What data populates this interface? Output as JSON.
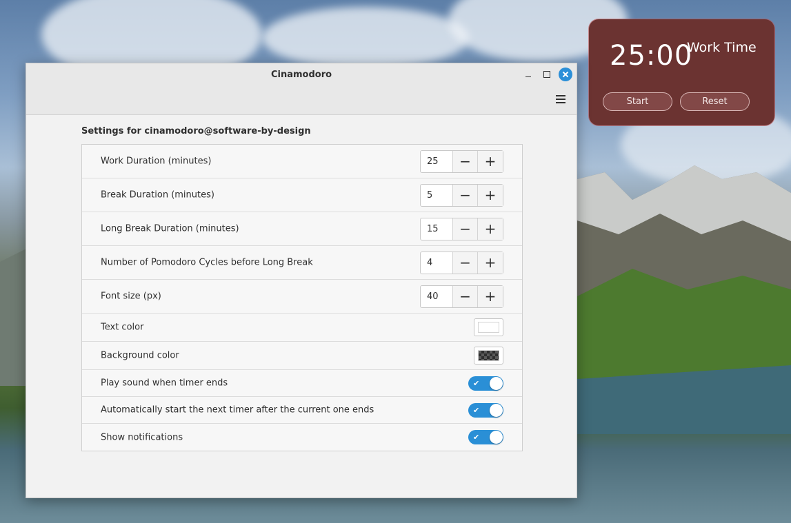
{
  "window": {
    "title": "Cinamodoro",
    "heading": "Settings for cinamodoro@software-by-design"
  },
  "timer": {
    "time": "25:00",
    "mode": "Work Time",
    "start_label": "Start",
    "reset_label": "Reset"
  },
  "settings": {
    "spin_rows": [
      {
        "label": "Work Duration (minutes)",
        "value": "25"
      },
      {
        "label": "Break Duration (minutes)",
        "value": "5"
      },
      {
        "label": "Long Break Duration (minutes)",
        "value": "15"
      },
      {
        "label": "Number of Pomodoro Cycles before Long Break",
        "value": "4"
      },
      {
        "label": "Font size (px)",
        "value": "40"
      }
    ],
    "color_rows": [
      {
        "label": "Text color",
        "color": "#ffffff"
      },
      {
        "label": "Background color",
        "color": "checkered-dark"
      }
    ],
    "toggle_rows": [
      {
        "label": "Play sound when timer ends",
        "enabled": true
      },
      {
        "label": "Automatically start the next timer after the current one ends",
        "enabled": true
      },
      {
        "label": "Show notifications",
        "enabled": true
      }
    ]
  },
  "icons": {
    "minus": "−",
    "plus": "+",
    "check": "✔"
  },
  "colors": {
    "accent": "#2a8fd6",
    "timer_bg": "#6b3331"
  }
}
